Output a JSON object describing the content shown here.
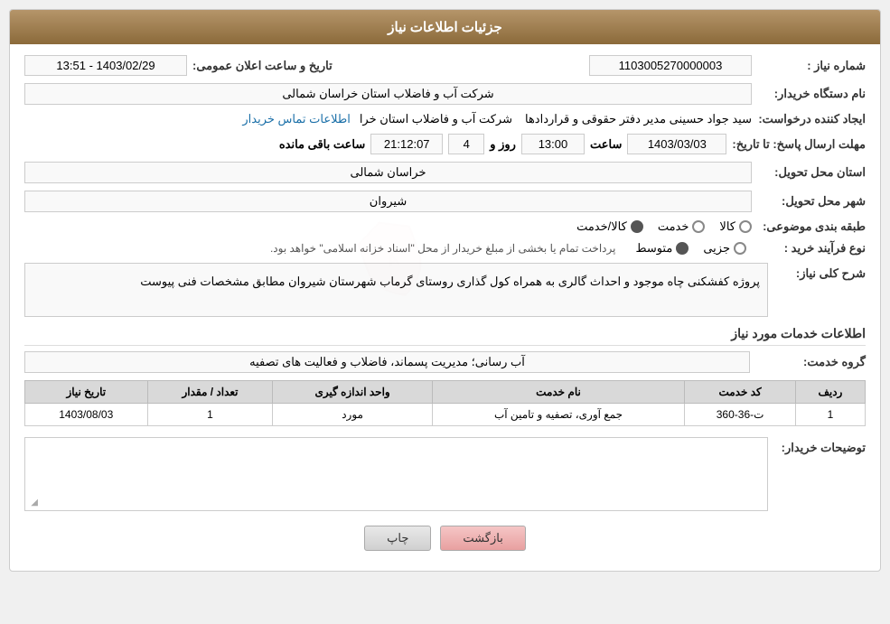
{
  "header": {
    "title": "جزئیات اطلاعات نیاز"
  },
  "fields": {
    "need_number_label": "شماره نیاز :",
    "need_number_value": "1103005270000003",
    "announce_date_label": "تاریخ و ساعت اعلان عمومی:",
    "announce_date_value": "1403/02/29 - 13:51",
    "buyer_name_label": "نام دستگاه خریدار:",
    "buyer_name_value": "شرکت آب و فاضلاب استان خراسان شمالی",
    "creator_label": "ایجاد کننده درخواست:",
    "creator_value": "سید جواد حسینی مدیر دفتر حقوقی و قراردادها",
    "creator_org": "شرکت آب و فاضلاب استان خرا",
    "creator_link": "اطلاعات تماس خریدار",
    "response_deadline_label": "مهلت ارسال پاسخ: تا تاریخ:",
    "response_date": "1403/03/03",
    "response_time_label": "ساعت",
    "response_time": "13:00",
    "response_days_label": "روز و",
    "response_days": "4",
    "response_remaining_label": "ساعت باقی مانده",
    "response_remaining": "21:12:07",
    "province_label": "استان محل تحویل:",
    "province_value": "خراسان شمالی",
    "city_label": "شهر محل تحویل:",
    "city_value": "شیروان",
    "category_label": "طبقه بندی موضوعی:",
    "category_options": [
      {
        "label": "کالا",
        "selected": false
      },
      {
        "label": "خدمت",
        "selected": false
      },
      {
        "label": "کالا/خدمت",
        "selected": true
      }
    ],
    "process_type_label": "نوع فرآیند خرید :",
    "process_options": [
      {
        "label": "جزیی",
        "selected": false
      },
      {
        "label": "متوسط",
        "selected": true
      }
    ],
    "process_note": "پرداخت تمام یا بخشی از مبلغ خریدار از محل \"اسناد خزانه اسلامی\" خواهد بود.",
    "description_label": "شرح کلی نیاز:",
    "description_value": "پروژه کفشکنی چاه موجود و احداث گالری به همراه کول گذاری روستای گرماب شهرستان شیروان مطابق مشخصات فنی پیوست",
    "services_section_label": "اطلاعات خدمات مورد نیاز",
    "service_group_label": "گروه خدمت:",
    "service_group_value": "آب رسانی؛ مدیریت پسماند، فاضلاب و فعالیت های تصفیه",
    "table": {
      "headers": [
        "ردیف",
        "کد خدمت",
        "نام خدمت",
        "واحد اندازه گیری",
        "تعداد / مقدار",
        "تاریخ نیاز"
      ],
      "rows": [
        {
          "row": "1",
          "code": "ت-36-360",
          "name": "جمع آوری، تصفیه و تامین آب",
          "unit": "مورد",
          "qty": "1",
          "date": "1403/08/03"
        }
      ]
    },
    "buyer_notes_label": "توضیحات خریدار:"
  },
  "buttons": {
    "print": "چاپ",
    "back": "بازگشت"
  }
}
